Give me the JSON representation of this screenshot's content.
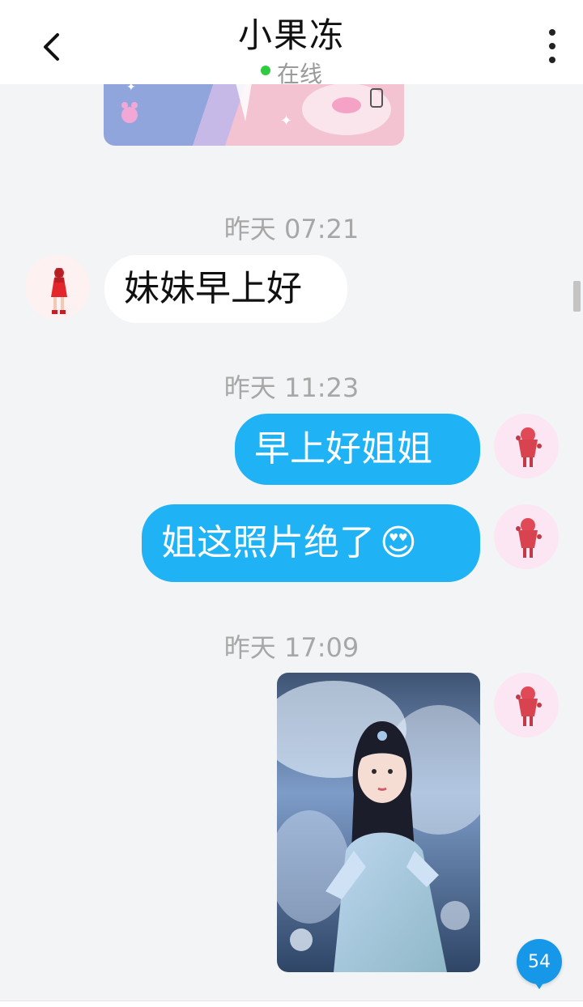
{
  "header": {
    "title": "小果冻",
    "status": "在线",
    "status_color": "#2ecc40"
  },
  "messages": {
    "ts1": "昨天 07:21",
    "in_msg1": "妹妹早上好",
    "ts2": "昨天 11:23",
    "out_msg1": "早上好姐姐",
    "out_msg2": "姐这照片绝了",
    "out_msg2_emoji": "😍",
    "ts3": "昨天 17:09"
  },
  "badge": {
    "count": "54"
  },
  "colors": {
    "outgoing_bubble": "#1fb2f5",
    "incoming_bubble": "#ffffff",
    "background": "#f3f4f6",
    "badge": "#1797e8"
  },
  "icons": {
    "back": "chevron-left-icon",
    "more": "vertical-ellipsis-icon"
  }
}
